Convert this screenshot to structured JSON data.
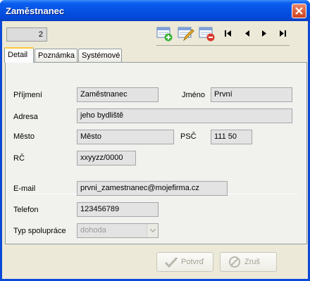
{
  "window": {
    "title": "Zaměstnanec"
  },
  "toolbar": {
    "record_number": "2",
    "icons": [
      "new-record-icon",
      "edit-record-icon",
      "delete-record-icon",
      "first-record-icon",
      "prev-record-icon",
      "next-record-icon",
      "last-record-icon"
    ]
  },
  "tabs": [
    {
      "label": "Detail",
      "active": true
    },
    {
      "label": "Poznámka",
      "active": false
    },
    {
      "label": "Systémové",
      "active": false
    }
  ],
  "form": {
    "surname": {
      "label": "Příjmení",
      "value": "Zaměstnanec"
    },
    "name": {
      "label": "Jméno",
      "value": "První"
    },
    "address": {
      "label": "Adresa",
      "value": "jeho bydliště"
    },
    "city": {
      "label": "Město",
      "value": "Město"
    },
    "zip": {
      "label": "PSČ",
      "value": "111 50"
    },
    "id": {
      "label": "RČ",
      "value": "xxyyzz/0000"
    },
    "email": {
      "label": "E-mail",
      "value": "prvni_zamestnanec@mojefirma.cz"
    },
    "phone": {
      "label": "Telefon",
      "value": "123456789"
    },
    "cooperation": {
      "label": "Typ spolupráce",
      "value": "dohoda"
    }
  },
  "buttons": {
    "confirm": "Potvrď",
    "cancel": "Zruš"
  }
}
